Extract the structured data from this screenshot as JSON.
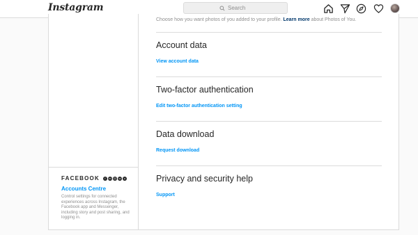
{
  "header": {
    "logo_text": "Instagram",
    "search_placeholder": "Search",
    "nav_icons": [
      "home-icon",
      "direct-send-icon",
      "explore-compass-icon",
      "activity-heart-icon",
      "profile-avatar"
    ]
  },
  "intro": {
    "text": "Choose how you want photos of you added to your profile. ",
    "link": "Learn more",
    "suffix": " about Photos of You."
  },
  "sections": [
    {
      "title": "Account data",
      "link": "View account data"
    },
    {
      "title": "Two-factor authentication",
      "link": "Edit two-factor authentication setting"
    },
    {
      "title": "Data download",
      "link": "Request download"
    },
    {
      "title": "Privacy and security help",
      "link": "Support"
    }
  ],
  "meta": {
    "facebook_wordmark": "FACEBOOK",
    "app_icons": [
      "facebook-icon",
      "messenger-icon",
      "instagram-icon",
      "whatsapp-icon",
      "oculus-icon"
    ],
    "accounts_centre_label": "Accounts Centre",
    "description": "Control settings for connected experiences across Instagram, the Facebook app and Messenger, including story and post sharing, and logging in."
  },
  "colors": {
    "link_blue": "#0095f6",
    "dark_link": "#00376b",
    "text": "#262626",
    "muted": "#8e8e8e",
    "border": "#dbdbdb",
    "background": "#fafafa"
  }
}
